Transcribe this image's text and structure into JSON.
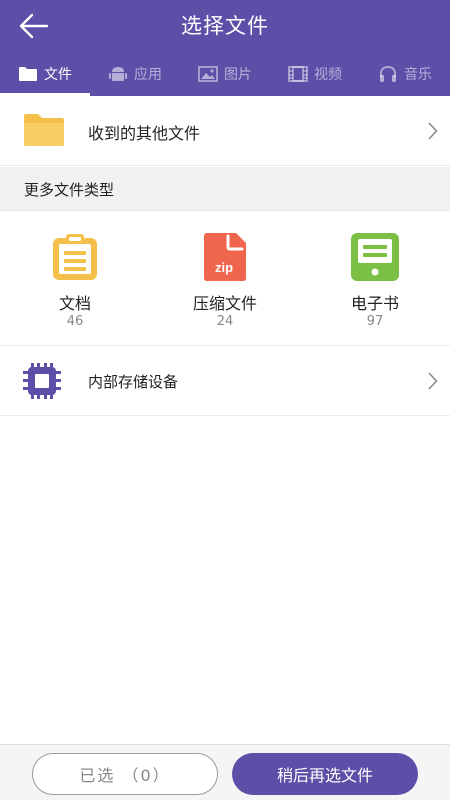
{
  "header": {
    "title": "选择文件",
    "back_icon": "arrow-left-icon",
    "color": "#5b4fa8"
  },
  "tabs": [
    {
      "label": "文件",
      "icon": "folder-icon",
      "active": true
    },
    {
      "label": "应用",
      "icon": "android-icon",
      "active": false
    },
    {
      "label": "图片",
      "icon": "image-icon",
      "active": false
    },
    {
      "label": "视频",
      "icon": "film-icon",
      "active": false
    },
    {
      "label": "音乐",
      "icon": "headphones-icon",
      "active": false
    }
  ],
  "received": {
    "label": "收到的其他文件",
    "icon": "folder-icon"
  },
  "more_types": {
    "header": "更多文件类型",
    "items": [
      {
        "name": "文档",
        "count": "46",
        "icon": "clipboard-document-icon",
        "color": "#f5c04a"
      },
      {
        "name": "压缩文件",
        "count": "24",
        "icon": "zip-file-icon",
        "icon_text": "zip",
        "color": "#f0654e"
      },
      {
        "name": "电子书",
        "count": "97",
        "icon": "ebook-icon",
        "color": "#7cbf45"
      }
    ]
  },
  "storage": {
    "label": "内部存储设备",
    "icon": "chip-icon",
    "color": "#5b4fa8"
  },
  "footer": {
    "selected_label": "已选 （0）",
    "later_label": "稍后再选文件"
  }
}
